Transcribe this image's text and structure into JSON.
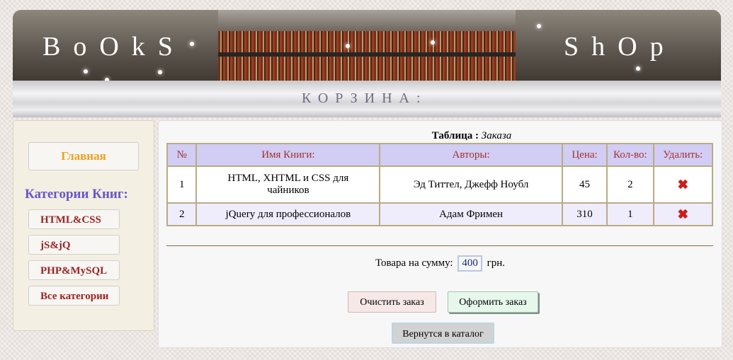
{
  "banner": {
    "brand_left": "BoOkS",
    "brand_right": "ShOp"
  },
  "subbar": {
    "title": "КОРЗИНА:"
  },
  "sidebar": {
    "home": "Главная",
    "categories_title": "Категории Книг:",
    "items": [
      {
        "label": "HTML&CSS"
      },
      {
        "label": "jS&jQ"
      },
      {
        "label": "PHP&MySQL"
      },
      {
        "label": "Все категории"
      }
    ]
  },
  "cart": {
    "caption_bold": "Таблица :",
    "caption_italic": "Заказа",
    "headers": {
      "num": "№",
      "name": "Имя Книги:",
      "authors": "Авторы:",
      "price": "Цена:",
      "qty": "Кол-во:",
      "delete": "Удалить:"
    },
    "rows": [
      {
        "num": "1",
        "name": "HTML, XHTML и CSS для чайников",
        "authors": "Эд Титтел, Джефф Ноубл",
        "price": "45",
        "qty": "2"
      },
      {
        "num": "2",
        "name": "jQuery для профессионалов",
        "authors": "Адам Фримен",
        "price": "310",
        "qty": "1"
      }
    ],
    "delete_icon": "delete-x-icon",
    "sum_label": "Товара на сумму:",
    "sum_value": "400",
    "sum_currency": "грн.",
    "clear_button": "Очистить заказ",
    "order_button": "Оформить заказ",
    "back_button": "Вернутся в каталог"
  },
  "colors": {
    "accent_orange": "#f0a020",
    "category_purple": "#6a56c8",
    "header_red": "#a0322f",
    "delete_red": "#d11a1a"
  }
}
